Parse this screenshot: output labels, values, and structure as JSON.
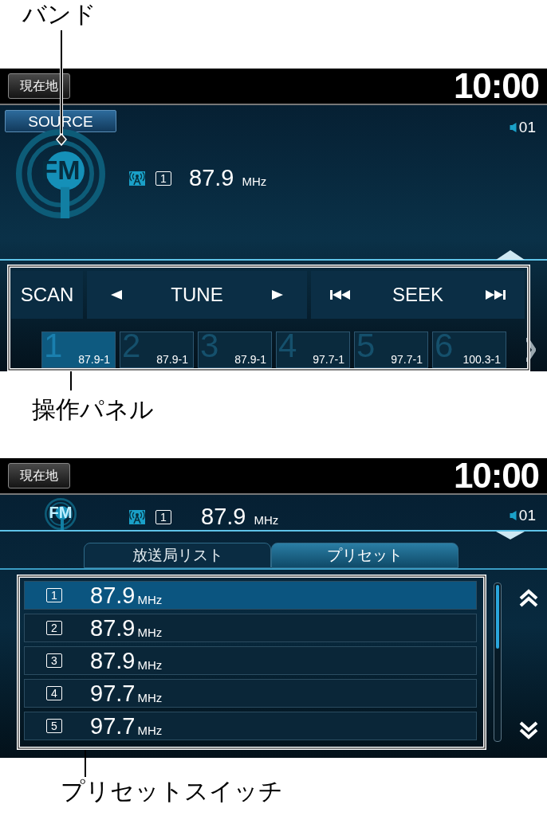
{
  "band_callout": {
    "label": "バンド"
  },
  "audio_screen": {
    "home_button": "現在地",
    "clock": "10:00",
    "source_button": "SOURCE",
    "volume": "01",
    "band_logo": "FM",
    "preset_number": "1",
    "frequency": "87.9",
    "unit": "MHz",
    "scan_button": "SCAN",
    "tune_label": "TUNE",
    "seek_label": "SEEK",
    "presets": [
      {
        "number": "1",
        "label": "87.9-1",
        "selected": true
      },
      {
        "number": "2",
        "label": "87.9-1",
        "selected": false
      },
      {
        "number": "3",
        "label": "87.9-1",
        "selected": false
      },
      {
        "number": "4",
        "label": "97.7-1",
        "selected": false
      },
      {
        "number": "5",
        "label": "97.7-1",
        "selected": false
      },
      {
        "number": "6",
        "label": "100.3-1",
        "selected": false
      }
    ]
  },
  "panel_callout": {
    "label": "操作パネル"
  },
  "preset_screen": {
    "home_button": "現在地",
    "clock": "10:00",
    "band_logo": "FM",
    "preset_number": "1",
    "frequency": "87.9",
    "unit": "MHz",
    "volume": "01",
    "tabs": [
      {
        "label": "放送局リスト",
        "selected": false
      },
      {
        "label": "プリセット",
        "selected": true
      }
    ],
    "presets": [
      {
        "number": "1",
        "frequency": "87.9",
        "unit": "MHz",
        "selected": true
      },
      {
        "number": "2",
        "frequency": "87.9",
        "unit": "MHz",
        "selected": false
      },
      {
        "number": "3",
        "frequency": "87.9",
        "unit": "MHz",
        "selected": false
      },
      {
        "number": "4",
        "frequency": "97.7",
        "unit": "MHz",
        "selected": false
      },
      {
        "number": "5",
        "frequency": "97.7",
        "unit": "MHz",
        "selected": false
      }
    ]
  },
  "preset_callout": {
    "label": "プリセットスイッチ"
  }
}
